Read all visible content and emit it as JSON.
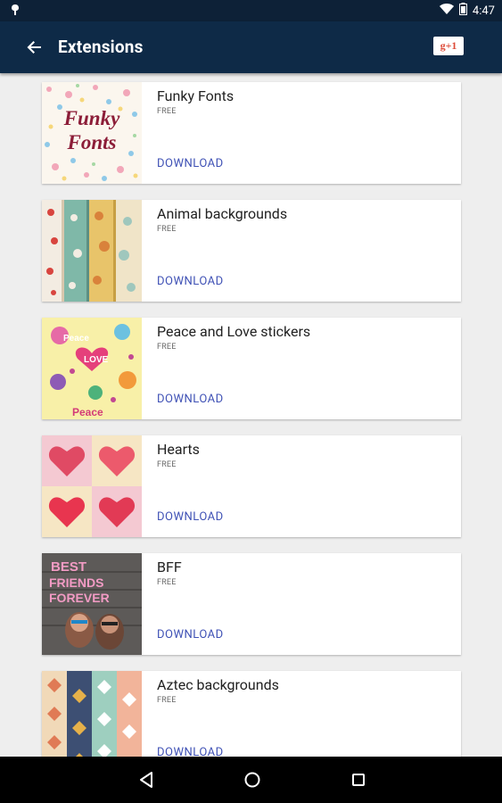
{
  "status": {
    "time": "4:47"
  },
  "appbar": {
    "title": "Extensions",
    "gplus_label": "g+1"
  },
  "extensions": [
    {
      "name": "Funky Fonts",
      "price": "FREE",
      "action": "DOWNLOAD",
      "thumb_text": [
        "Funky",
        "Fonts"
      ]
    },
    {
      "name": "Animal backgrounds",
      "price": "FREE",
      "action": "DOWNLOAD"
    },
    {
      "name": "Peace and Love stickers",
      "price": "FREE",
      "action": "DOWNLOAD",
      "thumb_text": [
        "Peace",
        "LOVE",
        "Peace"
      ]
    },
    {
      "name": "Hearts",
      "price": "FREE",
      "action": "DOWNLOAD"
    },
    {
      "name": "BFF",
      "price": "FREE",
      "action": "DOWNLOAD",
      "thumb_text": [
        "BEST",
        "FRIENDS",
        "FOREVER"
      ]
    },
    {
      "name": "Aztec backgrounds",
      "price": "FREE",
      "action": "DOWNLOAD"
    }
  ],
  "colors": {
    "appbar": "#0e2a47",
    "statusbar": "#0d2137",
    "link": "#3f51b5"
  }
}
